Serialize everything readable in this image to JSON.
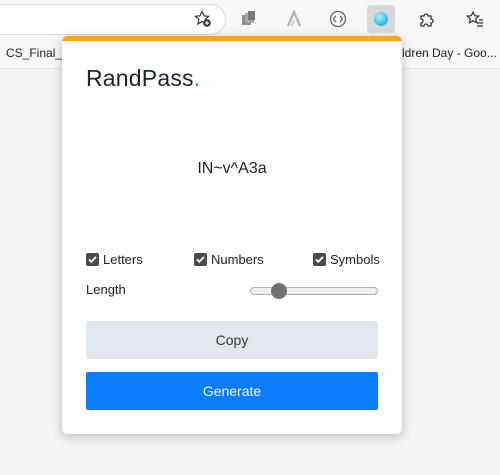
{
  "browser": {
    "bookmarks": [
      "CS_Final_X",
      "ldren Day - Goo..."
    ]
  },
  "popup": {
    "brand": "RandPass",
    "brand_dot": ".",
    "password": "IN~v^A3a",
    "options": [
      {
        "label": "Letters",
        "checked": true
      },
      {
        "label": "Numbers",
        "checked": true
      },
      {
        "label": "Symbols",
        "checked": true
      }
    ],
    "length_label": "Length",
    "length_fraction": 0.18,
    "copy_label": "Copy",
    "generate_label": "Generate"
  },
  "colors": {
    "accent": "#f5a623",
    "primary": "#0a7cff",
    "brand_dot": "#1a8cff"
  }
}
